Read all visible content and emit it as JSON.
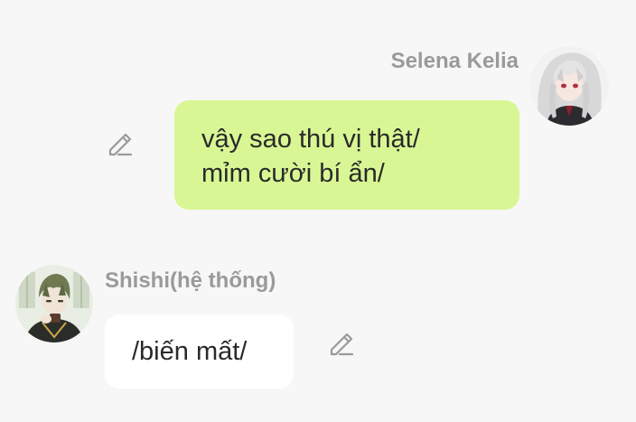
{
  "messages": [
    {
      "sender": "Selena Kelia",
      "lines": [
        "vậy sao thú vị thật/",
        "mỉm cười bí ẩn/"
      ],
      "bubble_color": "#d8f794",
      "avatar_icon": "anime-girl-avatar-icon",
      "edit_icon": "pencil-edit-icon"
    },
    {
      "sender": "Shishi(hệ thống)",
      "lines": [
        "/biến mất/"
      ],
      "bubble_color": "#ffffff",
      "avatar_icon": "anime-boy-avatar-icon",
      "edit_icon": "pencil-edit-icon"
    }
  ],
  "colors": {
    "background": "#f7f7f7",
    "name_text": "#9a9a9a",
    "message_text": "#2a2a2a"
  }
}
